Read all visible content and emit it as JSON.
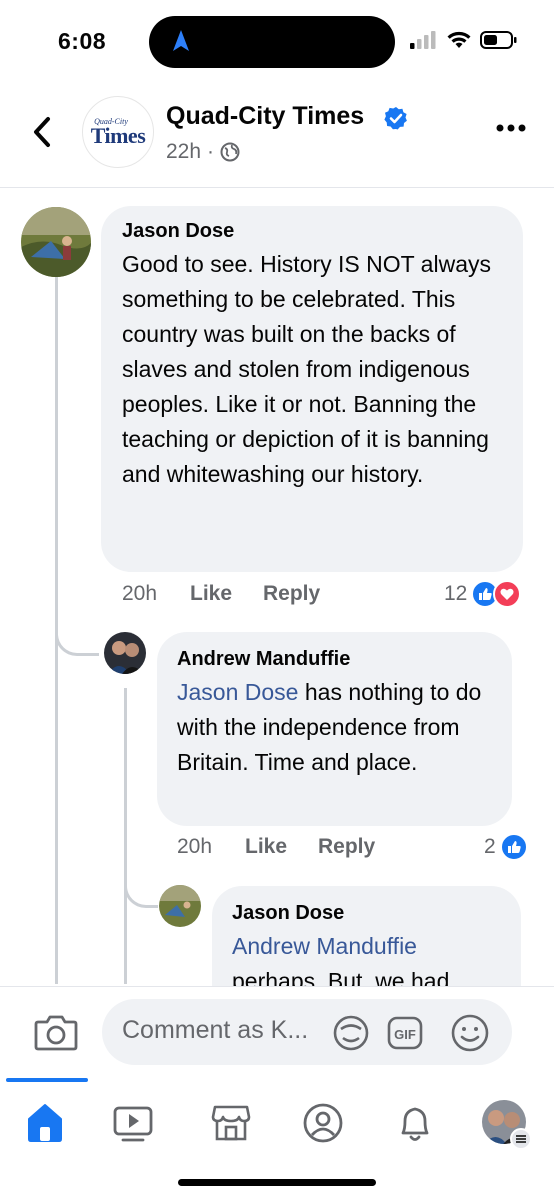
{
  "status": {
    "time": "6:08"
  },
  "header": {
    "page_name": "Quad-City Times",
    "logo_small": "Quad-City",
    "logo_big": "Times",
    "age": "22h",
    "separator": "·"
  },
  "comments": [
    {
      "author": "Jason Dose",
      "text": "Good to see.  History IS NOT always something to be celebrated.  This country was built on the backs of slaves and stolen from indigenous peoples.  Like it or not.  Banning the teaching or depiction of it is banning and whitewashing our history.",
      "time": "20h",
      "like_label": "Like",
      "reply_label": "Reply",
      "reaction_count": "12",
      "reactions": [
        "like",
        "love"
      ]
    },
    {
      "author": "Andrew Manduffie",
      "mention": "Jason Dose",
      "text": " has nothing to do with the independence from Britain. Time and place.",
      "time": "20h",
      "like_label": "Like",
      "reply_label": "Reply",
      "reaction_count": "2",
      "reactions": [
        "like"
      ]
    },
    {
      "author": "Jason Dose",
      "mention": "Andrew Manduffie",
      "text": "perhaps.  But, we had"
    }
  ],
  "comment_bar": {
    "placeholder": "Comment as K..."
  },
  "tabs": [
    "home-icon",
    "video-icon",
    "marketplace-icon",
    "profile-icon",
    "notifications-icon",
    "menu-avatar"
  ],
  "colors": {
    "accent": "#1877f2",
    "love": "#f33e58",
    "bubble": "#f0f2f5"
  }
}
